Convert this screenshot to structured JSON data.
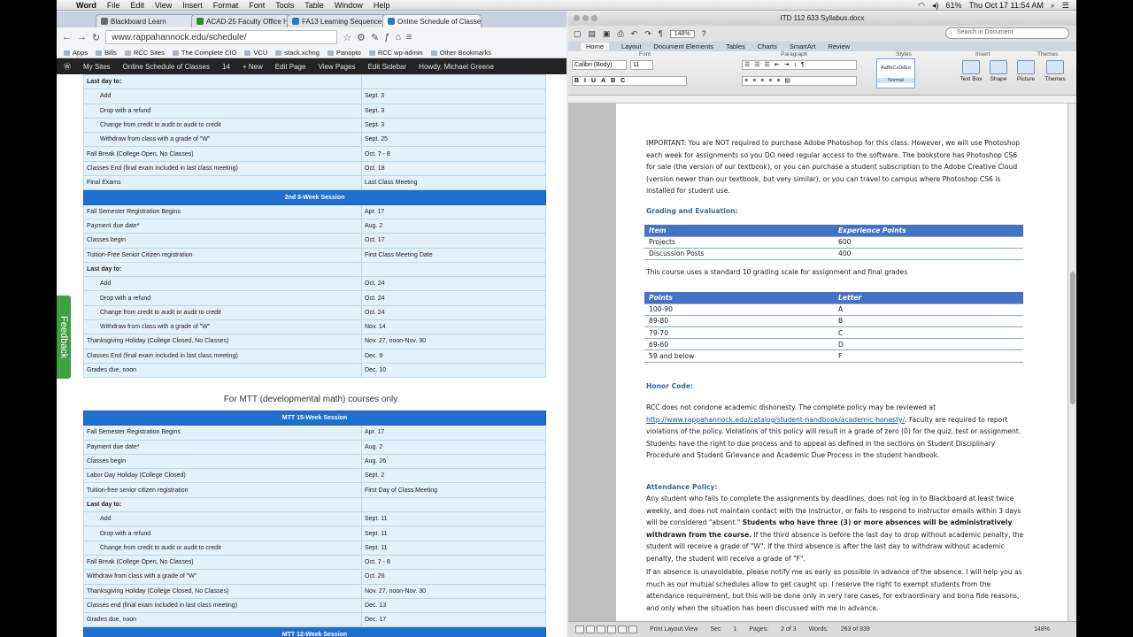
{
  "menubar": {
    "app": "Word",
    "items": [
      "File",
      "Edit",
      "View",
      "Insert",
      "Format",
      "Font",
      "Tools",
      "Table",
      "Window",
      "Help"
    ],
    "battery": "61%",
    "clock": "Thu Oct 17  11:54 AM"
  },
  "browser": {
    "tabs": [
      {
        "label": "Blackboard Learn",
        "color": "#6a6a6a"
      },
      {
        "label": "ACAD-25 Faculty Office H",
        "color": "#2a8a3a"
      },
      {
        "label": "FA13 Learning Sequence",
        "color": "#2a7ab8"
      },
      {
        "label": "Online Schedule of Classes",
        "color": "#2a7ab8"
      }
    ],
    "url": "www.rappahannock.edu/schedule/",
    "bookmarks": [
      "Apps",
      "Bills",
      "RCC Sites",
      "The Complete CIO",
      "VCU",
      "stack.xchng",
      "Panopto",
      "RCC wp-admin",
      "Other Bookmarks"
    ],
    "wpbar": [
      "My Sites",
      "Online Schedule of Classes",
      "14",
      "+ New",
      "Edit Page",
      "View Pages",
      "Edit Sidebar",
      "Howdy, Michael Greene"
    ],
    "feedback": "Feedback",
    "table1": [
      [
        "Last day to:",
        "",
        "sub"
      ],
      [
        "Add",
        "Sept. 3",
        "ind"
      ],
      [
        "Drop with a refund",
        "Sept. 3",
        "ind"
      ],
      [
        "Change from credit to audit or audit to credit",
        "Sept. 3",
        "ind"
      ],
      [
        "Withdraw from class with a grade of \"W\"",
        "Sept. 25",
        "ind"
      ],
      [
        "Fall Break (College Open, No Classes)",
        "Oct. 7 - 8",
        ""
      ],
      [
        "Classes End (final exam included in last class meeting)",
        "Oct. 18",
        ""
      ],
      [
        "Final Exams",
        "Last Class Meeting",
        ""
      ],
      [
        "2nd 8-Week Session",
        "",
        "hdr"
      ],
      [
        "Fall Semester Registration Begins",
        "Apr. 17",
        ""
      ],
      [
        "Payment due date*",
        "Aug. 2",
        ""
      ],
      [
        "Classes begin",
        "Oct. 17",
        ""
      ],
      [
        "Tuition-Free Senior Citizen registration",
        "First Class Meeting Date",
        ""
      ],
      [
        "Last day to:",
        "",
        "sub"
      ],
      [
        "Add",
        "Oct. 24",
        "ind"
      ],
      [
        "Drop with a refund",
        "Oct. 24",
        "ind"
      ],
      [
        "Change from credit to audit or audit to credit",
        "Oct. 24",
        "ind"
      ],
      [
        "Withdraw from class with a grade of \"W\"",
        "Nov. 14",
        "ind"
      ],
      [
        "Thanksgiving Holiday (College Closed, No Classes)",
        "Nov. 27, noon-Nov. 30",
        ""
      ],
      [
        "Classes End (final exam included in last class meeting)",
        "Dec. 9",
        ""
      ],
      [
        "Grades due, noon",
        "Dec. 10",
        ""
      ]
    ],
    "mtt_note": "For MTT (developmental math) courses only.",
    "table2": [
      [
        "MTT 15-Week Session",
        "",
        "hdr"
      ],
      [
        "Fall Semester Registration Begins",
        "Apr. 17",
        ""
      ],
      [
        "Payment due date*",
        "Aug. 2",
        ""
      ],
      [
        "Classes begin",
        "Aug. 26",
        ""
      ],
      [
        "Labor Day Holiday (College Closed)",
        "Sept. 2",
        ""
      ],
      [
        "Tuition-free senior citizen registration",
        "First Day of Class Meeting",
        ""
      ],
      [
        "Last day to:",
        "",
        "sub"
      ],
      [
        "Add",
        "Sept. 11",
        "ind"
      ],
      [
        "Drop with a refund",
        "Sept. 11",
        "ind"
      ],
      [
        "Change from credit to audit or audit to credit",
        "Sept. 11",
        "ind"
      ],
      [
        "Fall Break (College Open, No Classes)",
        "Oct. 7 - 8",
        ""
      ],
      [
        "Withdraw from class with a grade of \"W\"",
        "Oct. 26",
        ""
      ],
      [
        "Thanksgiving Holiday (College Closed, No Classes)",
        "Nov. 27, noon-Nov. 30",
        ""
      ],
      [
        "Classes end (final exam included in last class meeting)",
        "Dec. 13",
        ""
      ],
      [
        "Grades due, noon",
        "Dec. 17",
        ""
      ],
      [
        "MTT 12-Week Session",
        "",
        "hdr"
      ]
    ]
  },
  "word": {
    "doc_title": "ITD 112 633 Syllabus.docx",
    "zoom": "148%",
    "search_placeholder": "Search in Document",
    "ribbon_tabs": [
      "Home",
      "Layout",
      "Document Elements",
      "Tables",
      "Charts",
      "SmartArt",
      "Review"
    ],
    "groups": [
      "Font",
      "Paragraph",
      "Styles",
      "Insert",
      "Themes"
    ],
    "font_name": "Calibri (Body)",
    "font_size": "11",
    "style_name": "Normal",
    "style_preview": "AaBbCcDdEe",
    "insert_items": [
      "Text Box",
      "Shape",
      "Picture",
      "Themes"
    ],
    "important": "IMPORTANT: You are NOT required to purchase Adobe Photoshop for this class. However, we will use Photoshop each week for assignments so you DO need regular access to the software. The bookstore has Photoshop CS6 for sale (the version of our textbook), or you can purchase a student subscription to the Adobe Creative Cloud (version newer than our textbook, but very similar), or you can travel to campus where Photoshop CS6 is installed for student use.",
    "grading_heading": "Grading and Evaluation:",
    "grading_table": {
      "headers": [
        "Item",
        "Experience Points"
      ],
      "rows": [
        [
          "Projects",
          "600"
        ],
        [
          "Discussion Posts",
          "400"
        ]
      ]
    },
    "scale_text": "This course uses a standard 10 grading scale for assignment and final grades",
    "scale_table": {
      "headers": [
        "Points",
        "Letter"
      ],
      "rows": [
        [
          "100-90",
          "A"
        ],
        [
          "89-80",
          "B"
        ],
        [
          "79-70",
          "C"
        ],
        [
          "69-60",
          "D"
        ],
        [
          "59 and below",
          "F"
        ]
      ]
    },
    "honor_heading": "Honor Code:",
    "honor_pre": "RCC does not condone academic dishonesty.  The complete policy may be reviewed at ",
    "honor_link": "http://www.rappahannock.edu/catalog/student-handbook/academic-honesty/",
    "honor_post": ". Faculty are required to report violations of the policy.   Violations of this policy will result in a grade of zero (0) for the quiz, test or assignment. Students have the right to due process and to appeal as defined in the sections on Student Disciplinary Procedure and Student Grievance and Academic Due Process in the student handbook.",
    "attend_heading": "Attendance Policy:",
    "attend_pre": "Any student who fails to complete the assignments by deadlines, does not log in to Blackboard at least twice weekly, and does not maintain contact with the instructor, or fails to respond to instructor emails within 3 days will be considered \"absent.\" ",
    "attend_bold": "Students who have three (3) or more absences will be administratively withdrawn from the course.",
    "attend_post": "  If the third absence is before the last day to drop without academic penalty, the student will receive a grade of \"W\".  If the third absence is after the last day to withdraw without academic penalty, the student will receive a grade of \"F\".",
    "unavoidable": "If an absence is unavoidable, please notify me as early as possible in advance of the absence.  I will help you as much as our mutual schedules allow to get caught up.  I reserve the right to exempt students from the attendance requirement, but this will be done only in very rare cases, for extraordinary and bona fide reasons, and only when the situation has been discussed with me in advance.",
    "status": {
      "view": "Print Layout View",
      "sec": "Sec",
      "sec_val": "1",
      "pages": "Pages:",
      "pages_val": "2 of 3",
      "words": "Words:",
      "words_val": "263 of 839",
      "zoom": "148%"
    }
  }
}
